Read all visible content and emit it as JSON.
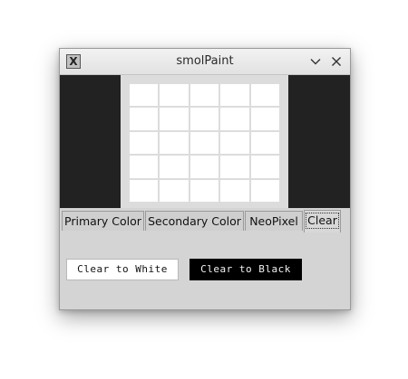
{
  "window": {
    "title": "smolPaint",
    "app_icon": "app-logo-icon",
    "controls": [
      "minimize-chevron-icon",
      "close-icon"
    ]
  },
  "canvas": {
    "rows": 5,
    "cols": 5,
    "cell_color": "#ffffff",
    "background_color": "#222222"
  },
  "tabs": [
    {
      "label": "Primary Color",
      "active": false
    },
    {
      "label": "Secondary Color",
      "active": false
    },
    {
      "label": "NeoPixel",
      "active": false
    },
    {
      "label": "Clear",
      "active": true
    }
  ],
  "panel": {
    "clear_white_label": "Clear to White",
    "clear_black_label": "Clear to Black"
  }
}
